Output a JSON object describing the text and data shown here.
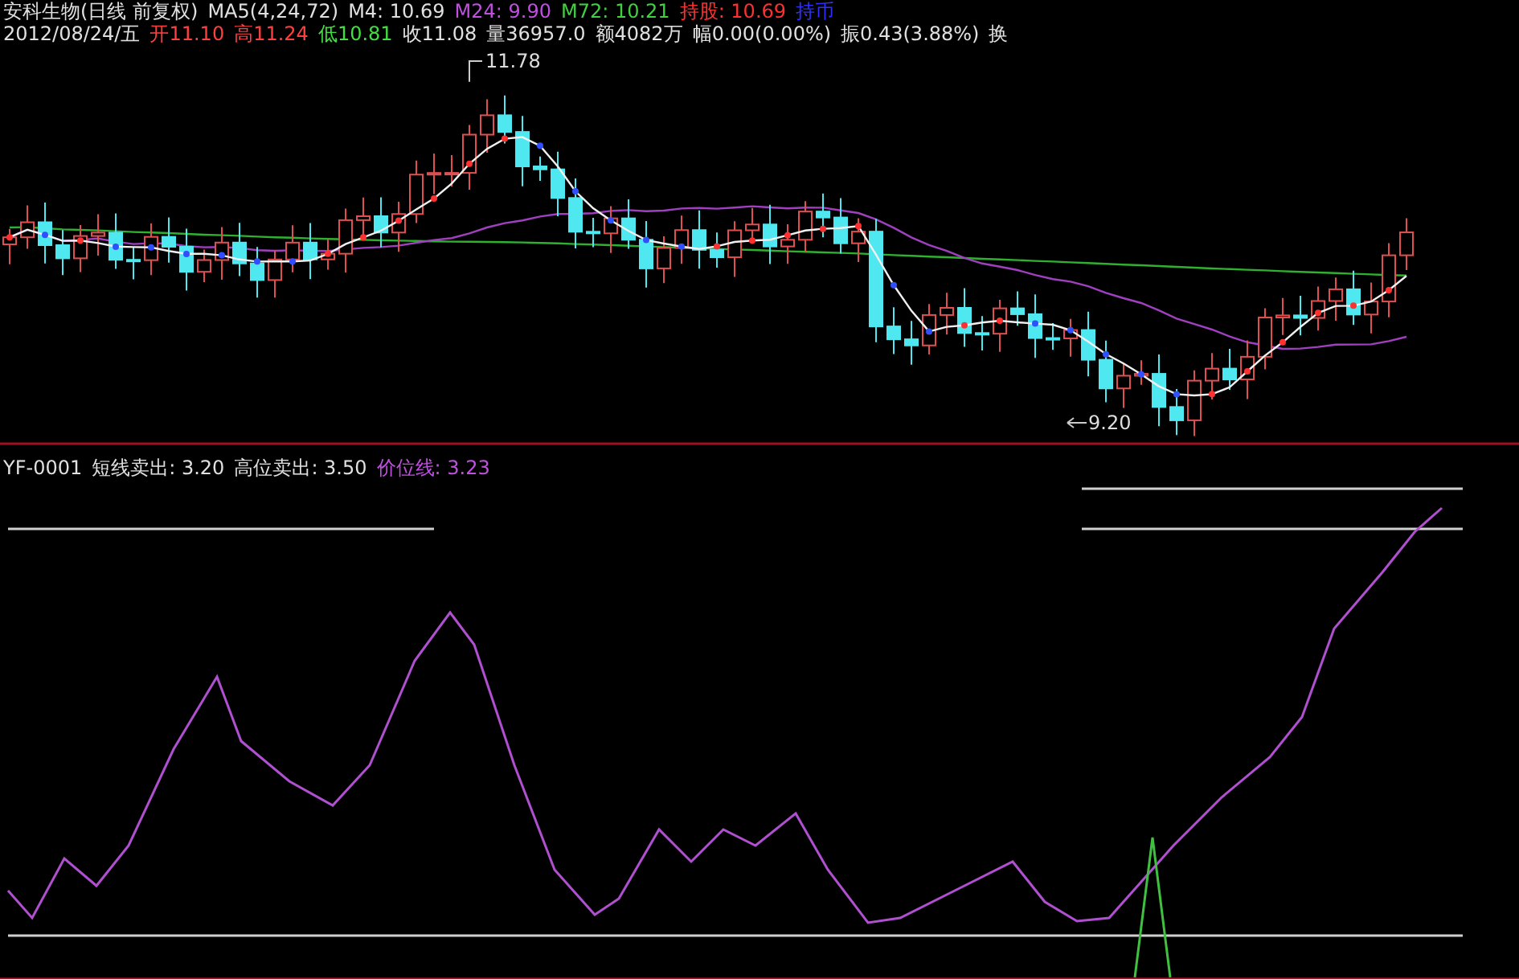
{
  "header": {
    "title": "安科生物(日线 前复权)",
    "ma_label": "MA5(4,24,72)",
    "ma_values": [
      {
        "text": "M4: 10.69",
        "color": "#e0e0e0"
      },
      {
        "text": "M24: 9.90",
        "color": "#c050e0"
      },
      {
        "text": "M72: 10.21",
        "color": "#40d040"
      },
      {
        "text": "持股: 10.69",
        "color": "#ff3030"
      },
      {
        "text": "持币",
        "color": "#3030ff"
      }
    ],
    "date": "2012/08/24/五",
    "quote": [
      {
        "label": "开",
        "value": "11.10",
        "color": "#ff4040"
      },
      {
        "label": "高",
        "value": "11.24",
        "color": "#ff4040"
      },
      {
        "label": "低",
        "value": "10.81",
        "color": "#40e040"
      },
      {
        "label": "收",
        "value": "11.08",
        "color": "#e0e0e0"
      },
      {
        "label": "量",
        "value": "36957.0",
        "color": "#e0e0e0"
      },
      {
        "label": "额",
        "value": "4082万",
        "color": "#e0e0e0"
      },
      {
        "label": "幅",
        "value": "0.00(0.00%)",
        "color": "#e0e0e0"
      },
      {
        "label": "振",
        "value": "0.43(3.88%)",
        "color": "#e0e0e0"
      },
      {
        "label": "换",
        "color": "#e0e0e0"
      }
    ]
  },
  "price_chart": {
    "high_label": "11.78",
    "low_label": "9.20"
  },
  "indicator": {
    "name": "YF-0001",
    "values": [
      {
        "text": "短线卖出: 3.20",
        "color": "#e0e0e0"
      },
      {
        "text": "高位卖出: 3.50",
        "color": "#e0e0e0"
      },
      {
        "text": "价位线: 3.23",
        "color": "#c050e0"
      }
    ]
  }
}
